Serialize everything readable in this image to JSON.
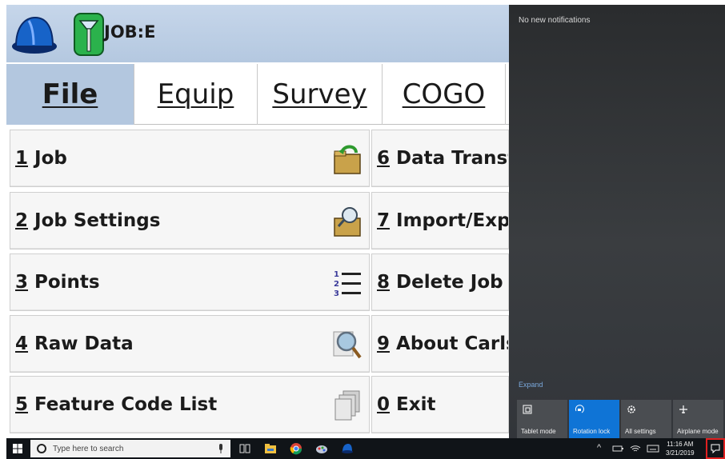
{
  "header": {
    "job_label": "JOB:E"
  },
  "tabs": [
    {
      "label": "File",
      "active": true
    },
    {
      "label": "Equip",
      "active": false
    },
    {
      "label": "Survey",
      "active": false
    },
    {
      "label": "COGO",
      "active": false
    }
  ],
  "menu": {
    "left": [
      {
        "num": "1",
        "label": "Job",
        "icon": "open-folder-icon"
      },
      {
        "num": "2",
        "label": "Job Settings",
        "icon": "folder-settings-icon"
      },
      {
        "num": "3",
        "label": "Points",
        "icon": "numbered-list-icon"
      },
      {
        "num": "4",
        "label": "Raw Data",
        "icon": "magnifier-icon"
      },
      {
        "num": "5",
        "label": "Feature Code List",
        "icon": "stacked-pages-icon"
      }
    ],
    "right": [
      {
        "num": "6",
        "label": "Data Transfe"
      },
      {
        "num": "7",
        "label": "Import/Expo"
      },
      {
        "num": "8",
        "label": "Delete Job"
      },
      {
        "num": "9",
        "label": "About Carlso"
      },
      {
        "num": "0",
        "label": "Exit"
      }
    ]
  },
  "notifications": {
    "empty_text": "No new notifications",
    "expand_label": "Expand",
    "quick_actions": [
      {
        "label": "Tablet mode",
        "active": false,
        "icon": "tablet-mode-icon"
      },
      {
        "label": "Rotation lock",
        "active": true,
        "icon": "rotation-lock-icon"
      },
      {
        "label": "All settings",
        "active": false,
        "icon": "settings-gear-icon"
      },
      {
        "label": "Airplane mode",
        "active": false,
        "icon": "airplane-icon"
      }
    ]
  },
  "taskbar": {
    "search_placeholder": "Type here to search",
    "time": "11:16 AM",
    "date": "3/21/2019"
  },
  "colors": {
    "header_bg": "#b4c8e0",
    "active_tab": "#b3c7df",
    "quick_action_on": "#0f74d6",
    "action_center_highlight": "#e02020"
  }
}
